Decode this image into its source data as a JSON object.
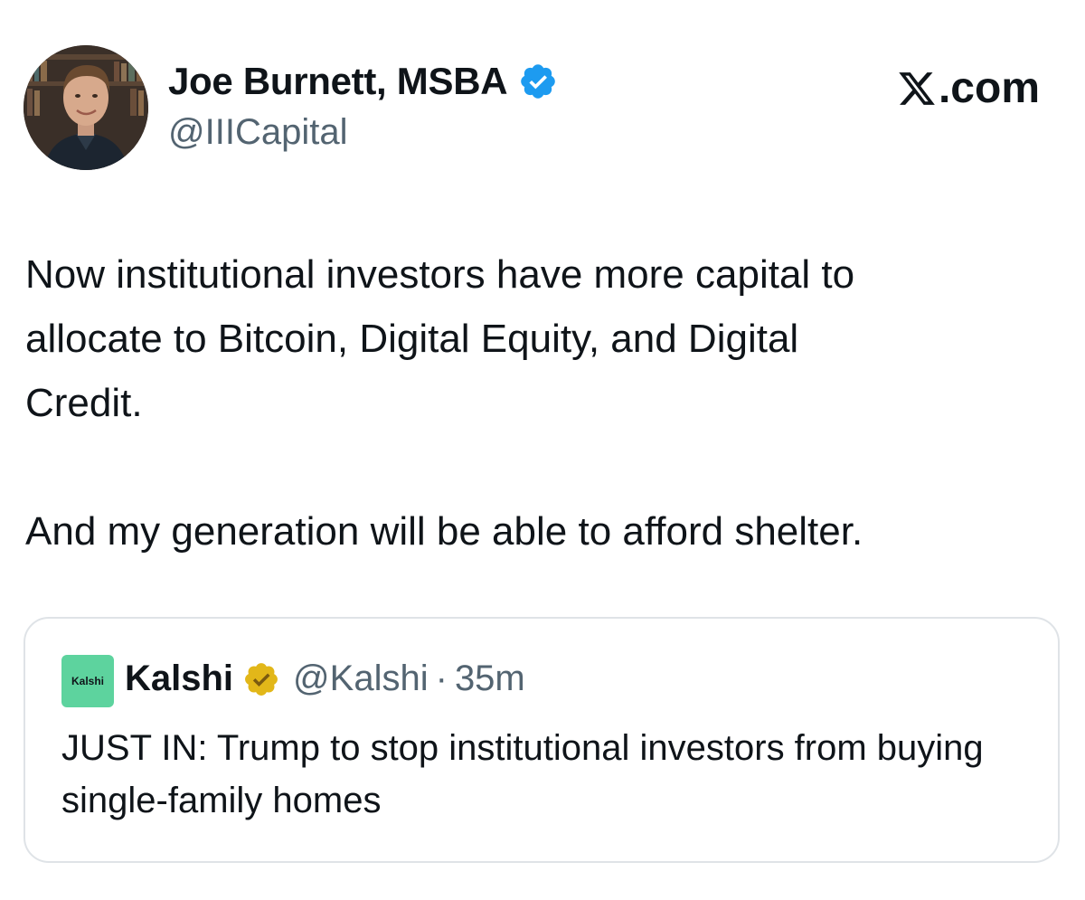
{
  "brand": {
    "label": ".com",
    "icon": "x-logo-icon"
  },
  "author": {
    "name": "Joe Burnett, MSBA",
    "handle": "@IIICapital",
    "verified_color": "#1d9bf0"
  },
  "tweet": {
    "text": "Now institutional investors have more capital to\nallocate to Bitcoin, Digital Equity, and Digital\nCredit.\n\nAnd my generation will be able to afford shelter."
  },
  "quoted": {
    "avatar_label": "Kalshi",
    "avatar_color": "#5dd39e",
    "name": "Kalshi",
    "badge_color": "#e2b719",
    "handle": "@Kalshi",
    "separator": "·",
    "time": "35m",
    "text": "JUST IN: Trump to stop institutional investors from buying single-family homes"
  }
}
